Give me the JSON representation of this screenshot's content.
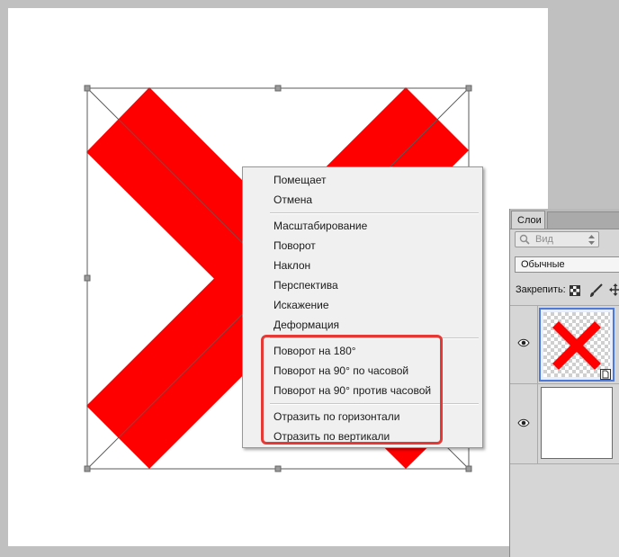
{
  "context_menu": {
    "items": [
      {
        "label": "Помещает"
      },
      {
        "label": "Отмена"
      },
      {
        "label": "Масштабирование"
      },
      {
        "label": "Поворот"
      },
      {
        "label": "Наклон"
      },
      {
        "label": "Перспектива"
      },
      {
        "label": "Искажение"
      },
      {
        "label": "Деформация"
      },
      {
        "label": "Поворот на 180°"
      },
      {
        "label": "Поворот на 90° по часовой"
      },
      {
        "label": "Поворот на 90° против часовой"
      },
      {
        "label": "Отразить по горизонтали"
      },
      {
        "label": "Отразить по вертикали"
      }
    ]
  },
  "layers_panel": {
    "tab_label": "Слои",
    "search_placeholder": "Вид",
    "blend_mode": "Обычные",
    "lock_label": "Закрепить:"
  },
  "colors": {
    "shape_fill": "#ff0000",
    "highlight": "#e53935",
    "menu_bg": "#f0f0f0"
  }
}
